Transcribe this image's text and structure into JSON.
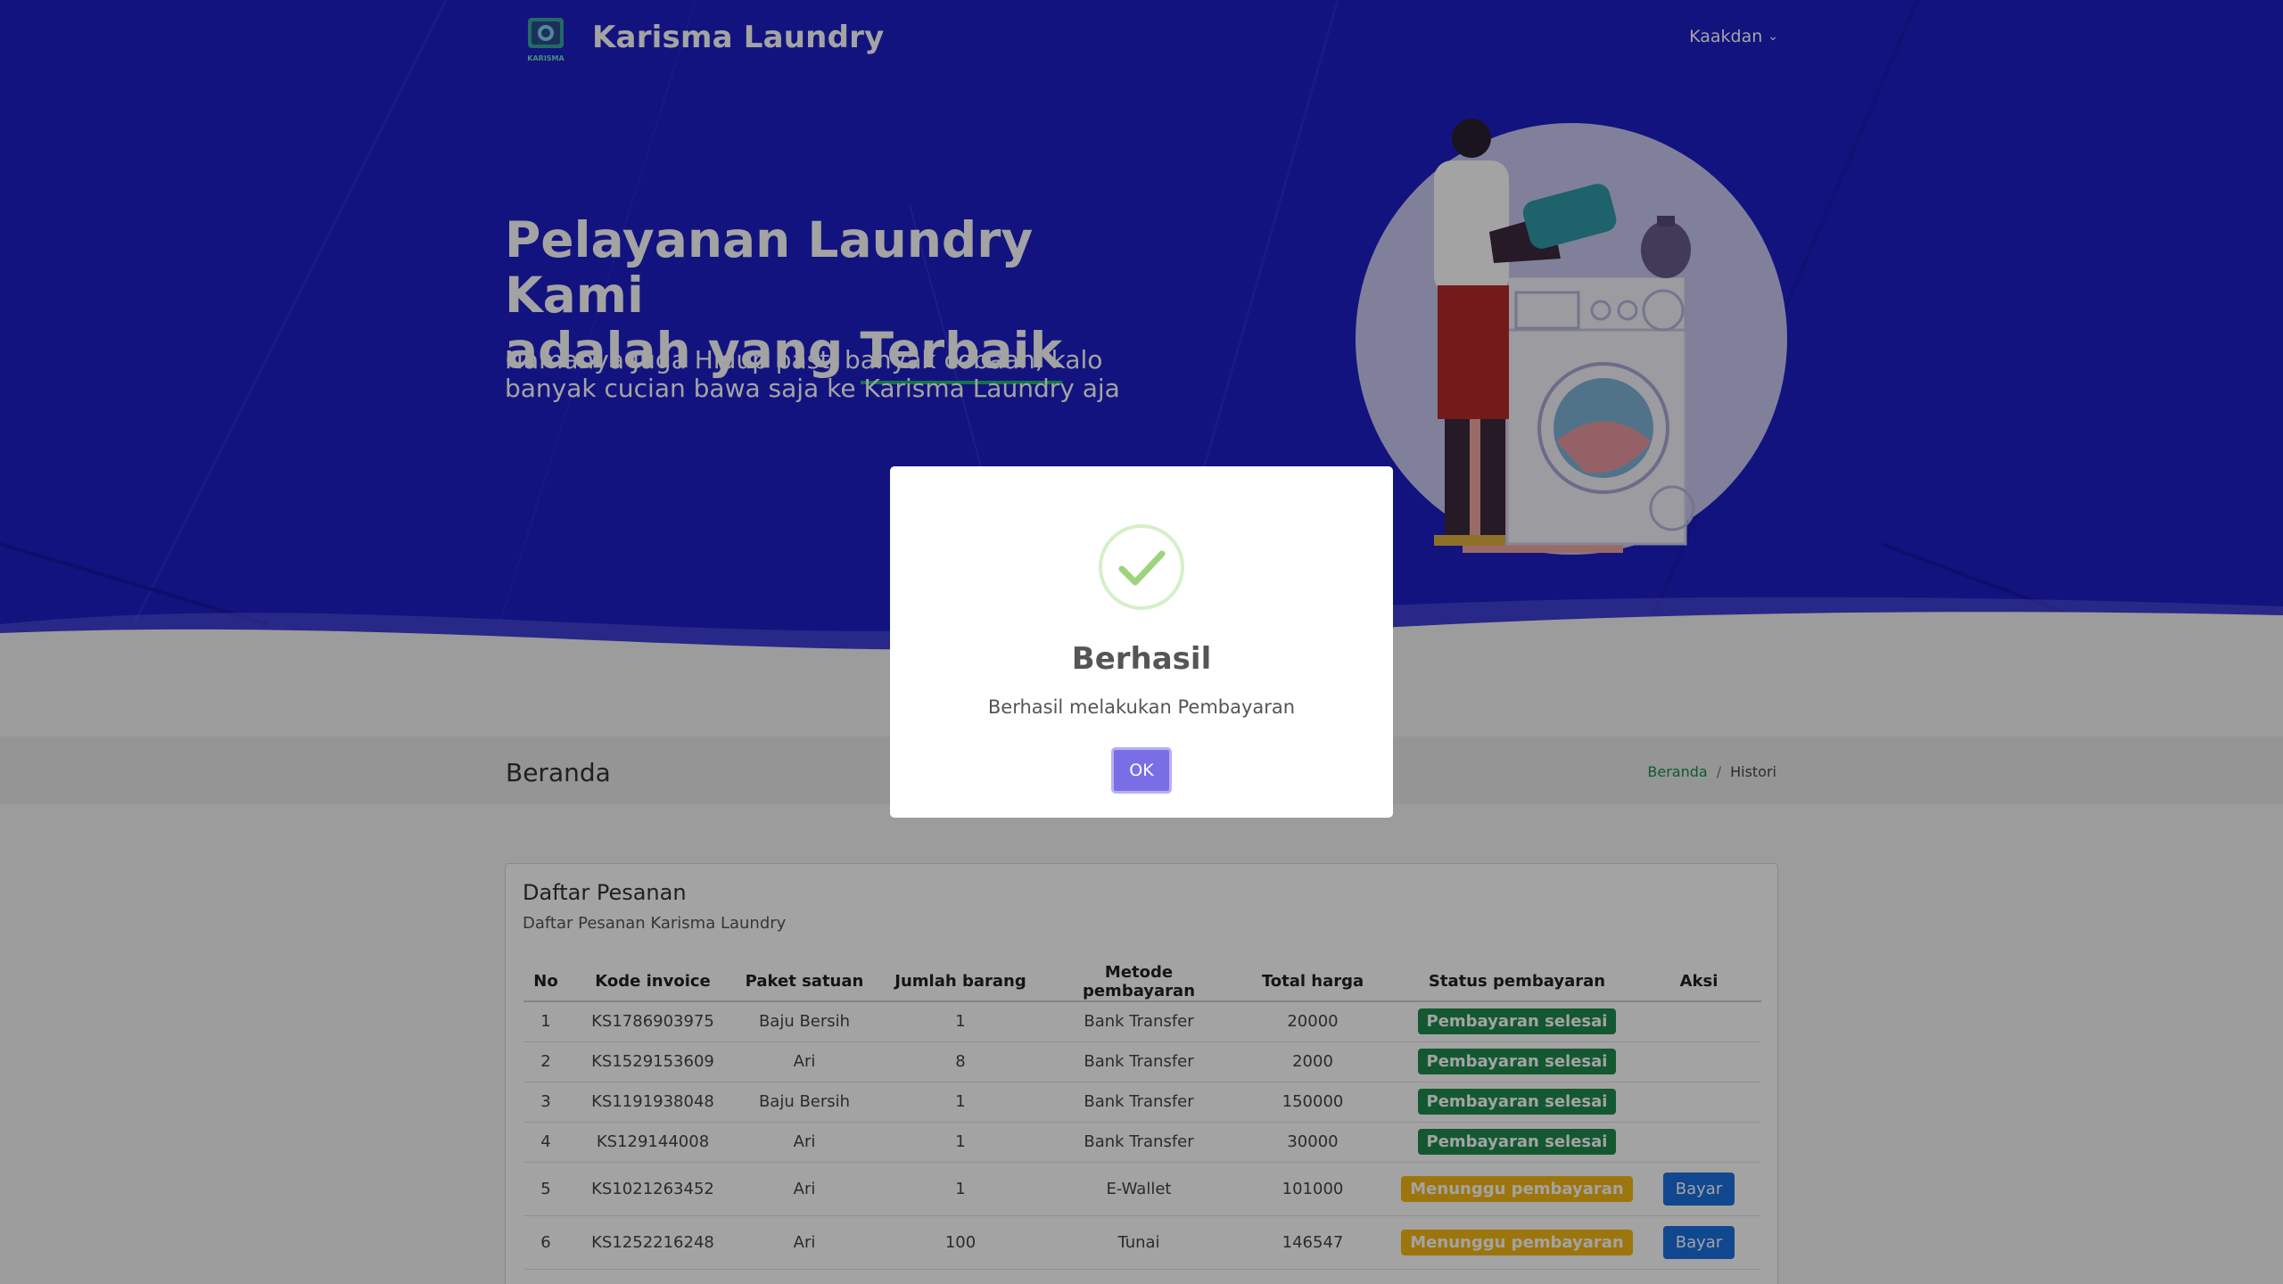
{
  "navbar": {
    "brand": "Karisma Laundry",
    "user": "Kaakdan",
    "logo_text": "KARISMA"
  },
  "hero": {
    "title_line1": "Pelayanan Laundry Kami",
    "title_line2_prefix": "adalah yang ",
    "title_highlight": "Terbaik",
    "subtitle": "Namanya Juga Hidup pasti banyak cobaan, kalo banyak cucian bawa saja ke Karisma Laundry aja"
  },
  "page": {
    "title": "Beranda",
    "breadcrumb": [
      "Beranda",
      "/",
      "Histori"
    ]
  },
  "card": {
    "title": "Daftar Pesanan",
    "subtitle": "Daftar Pesanan Karisma Laundry",
    "headers": [
      "No",
      "Kode invoice",
      "Paket satuan",
      "Jumlah barang",
      "Metode pembayaran",
      "Total harga",
      "Status pembayaran",
      "Aksi"
    ],
    "rows": [
      {
        "no": "1",
        "invoice": "KS1786903975",
        "paket": "Baju Bersih",
        "jumlah": "1",
        "metode": "Bank Transfer",
        "total": "20000",
        "status": "Pembayaran selesai",
        "aksi": ""
      },
      {
        "no": "2",
        "invoice": "KS1529153609",
        "paket": "Ari",
        "jumlah": "8",
        "metode": "Bank Transfer",
        "total": "2000",
        "status": "Pembayaran selesai",
        "aksi": ""
      },
      {
        "no": "3",
        "invoice": "KS1191938048",
        "paket": "Baju Bersih",
        "jumlah": "1",
        "metode": "Bank Transfer",
        "total": "150000",
        "status": "Pembayaran selesai",
        "aksi": ""
      },
      {
        "no": "4",
        "invoice": "KS129144008",
        "paket": "Ari",
        "jumlah": "1",
        "metode": "Bank Transfer",
        "total": "30000",
        "status": "Pembayaran selesai",
        "aksi": ""
      },
      {
        "no": "5",
        "invoice": "KS1021263452",
        "paket": "Ari",
        "jumlah": "1",
        "metode": "E-Wallet",
        "total": "101000",
        "status": "Menunggu pembayaran",
        "aksi": "Bayar"
      },
      {
        "no": "6",
        "invoice": "KS1252216248",
        "paket": "Ari",
        "jumlah": "100",
        "metode": "Tunai",
        "total": "146547",
        "status": "Menunggu pembayaran",
        "aksi": "Bayar"
      }
    ]
  },
  "modal": {
    "title": "Berhasil",
    "message": "Berhasil melakukan Pembayaran",
    "ok_label": "OK"
  },
  "colors": {
    "hero_bg": "#1e1ec7",
    "accent_green": "#1e8a4e",
    "badge_wait": "#f5b914",
    "pay_button": "#1a6fe0",
    "ok_button": "#7a6ee6"
  },
  "icons": [
    "logo-icon",
    "chevron-down-icon",
    "success-check-icon"
  ]
}
